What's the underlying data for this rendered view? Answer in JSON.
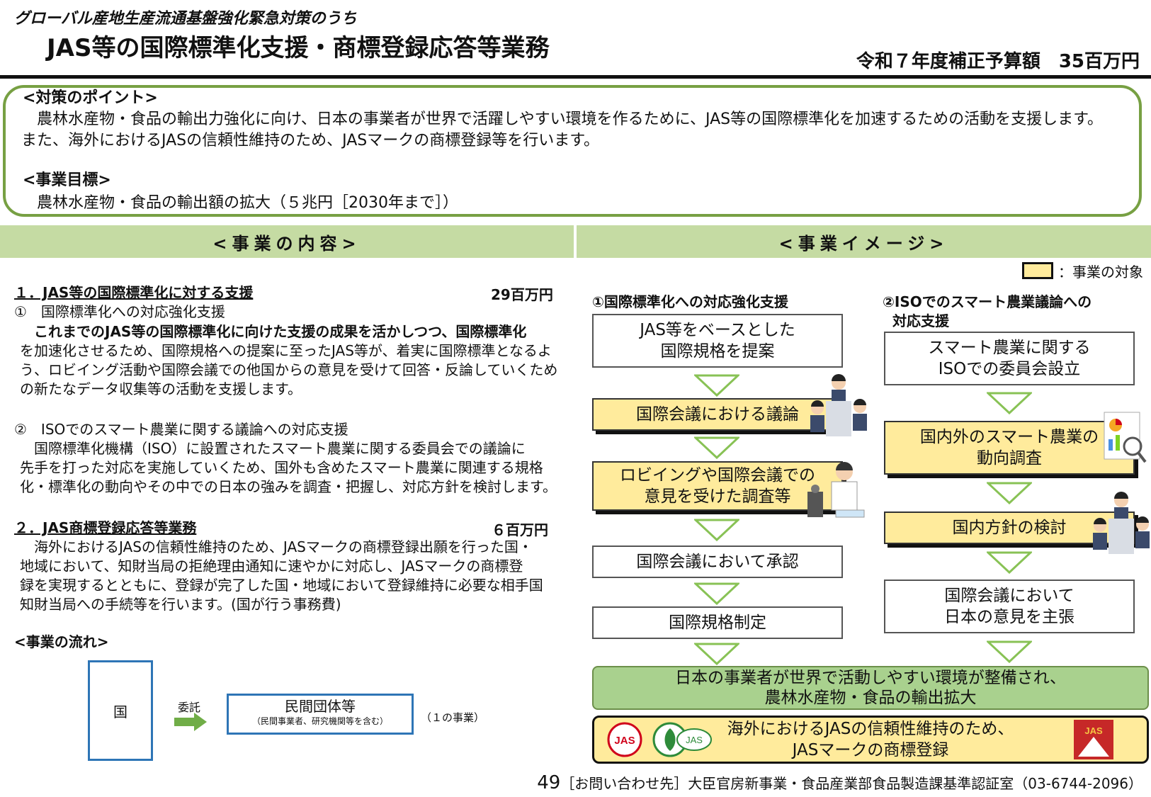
{
  "header": {
    "supertitle": "グローバル産地生産流通基盤強化緊急対策のうち",
    "title": "JAS等の国際標準化支援・商標登録応答等業務",
    "budget": "令和７年度補正予算額　35百万円"
  },
  "points": {
    "heading1": "<対策のポイント>",
    "body1a": "　農林水産物・食品の輸出力強化に向け、日本の事業者が世界で活躍しやすい環境を作るために、JAS等の国際標準化を加速するための活動を支援します。",
    "body1b": "また、海外におけるJASの信頼性維持のため、JASマークの商標登録等を行います。",
    "heading2": "<事業目標>",
    "body2": "　農林水産物・食品の輸出額の拡大（５兆円［2030年まで］）"
  },
  "sections": {
    "left_title": "<事業の内容>",
    "right_title": "<事業イメージ>"
  },
  "content": {
    "item1_title": "１．JAS等の国際標準化に対する支援",
    "item1_amount": "29百万円",
    "item1_sub1": "①　国際標準化への対応強化支援",
    "item1_p1_line1": "　これまでのJAS等の国際標準化に向けた支援の成果を活かしつつ、国際標準化",
    "item1_p1_line2": "を加速化させるため、国際規格への提案に至ったJAS等が、着実に国際標準となるよ",
    "item1_p1_line3": "う、ロビイング活動や国際会議での他国からの意見を受けて回答・反論していくため",
    "item1_p1_line4": "の新たなデータ収集等の活動を支援します。",
    "item1_sub2": "②　ISOでのスマート農業に関する議論への対応支援",
    "item1_p2_line1": "　国際標準化機構（ISO）に設置されたスマート農業に関する委員会での議論に",
    "item1_p2_line2": "先手を打った対応を実施していくため、国外も含めたスマート農業に関連する規格",
    "item1_p2_line3": "化・標準化の動向やその中での日本の強みを調査・把握し、対応方針を検討します。",
    "item2_title": "２．JAS商標登録応答等業務",
    "item2_amount": "６百万円",
    "item2_line1": "　海外におけるJASの信頼性維持のため、JASマークの商標登録出願を行った国・",
    "item2_line2": "地域において、知財当局の拒絶理由通知に速やかに対応し、JASマークの商標登",
    "item2_line3": "録を実現するとともに、登録が完了した国・地域において登録維持に必要な相手国",
    "item2_line4": "知財当局への手続等を行います。(国が行う事務費)",
    "flow_heading": "<事業の流れ>",
    "flow_country": "国",
    "flow_consign": "委託",
    "flow_org": "民間団体等",
    "flow_org_note": "（民間事業者、研究機関等を含む）",
    "flow_count": "（１の事業）"
  },
  "image": {
    "legend": "：事業の対象",
    "col1_title": "①国際標準化への対応強化支援",
    "col1_boxes": [
      "JAS等をベースとした\n国際規格を提案",
      "国際会議における議論",
      "ロビイングや国際会議での\n意見を受けた調査等",
      "国際会議において承認",
      "国際規格制定"
    ],
    "col2_title_line1": "②ISOでのスマート農業議論への",
    "col2_title_line2": "対応支援",
    "col2_boxes": [
      "スマート農業に関する\nISOでの委員会設立",
      "国内外のスマート農業の\n動向調査",
      "国内方針の検討",
      "国際会議において\n日本の意見を主張"
    ],
    "result_green_line1": "日本の事業者が世界で活動しやすい環境が整備され、",
    "result_green_line2": "農林水産物・食品の輸出拡大",
    "result_yellow_line1": "海外におけるJASの信頼性維持のため、",
    "result_yellow_line2": "JASマークの商標登録",
    "jas_mark_text": "JAS",
    "colors": {
      "green_border": "#77a043",
      "section_bar": "#c5dba3",
      "target_yellow": "#ffeb9c",
      "result_green": "#a9d18e",
      "arrow_green": "#88c255",
      "flow_blue": "#2e75b6"
    }
  },
  "footer": {
    "page": "49",
    "contact": "［お問い合わせ先］大臣官房新事業・食品産業部食品製造課基準認証室（03-6744-2096）"
  }
}
